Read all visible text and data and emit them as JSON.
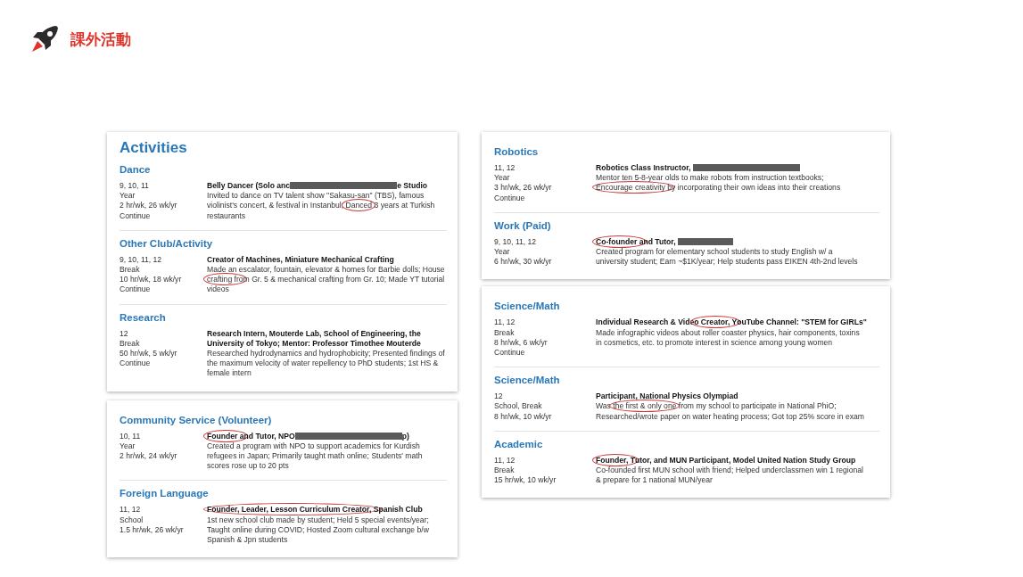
{
  "header": {
    "title": "課外活動"
  },
  "columns": [
    {
      "cards": [
        {
          "heading": "Activities",
          "entries": [
            {
              "category": "Dance",
              "meta": [
                "9, 10, 11",
                "Year",
                "2 hr/wk, 26 wk/yr",
                "Continue"
              ],
              "title": [
                {
                  "kind": "text",
                  "text": "Belly Dancer (Solo anc"
                },
                {
                  "kind": "redacted_long"
                },
                {
                  "kind": "text",
                  "text": "e Studio"
                }
              ],
              "description": [
                {
                  "kind": "text",
                  "text": "Invited to dance on TV talent show \"Sakasu-san\" (TBS), famous violinist's concert, & festival in Instanbul; "
                },
                {
                  "kind": "text",
                  "text": "Danced",
                  "circled": true
                },
                {
                  "kind": "text",
                  "text": " 3 years at Turkish restaurants"
                }
              ]
            },
            {
              "category": "Other Club/Activity",
              "meta": [
                "9, 10, 11, 12",
                "Break",
                "10 hr/wk, 18 wk/yr",
                "Continue"
              ],
              "title": [
                {
                  "kind": "text",
                  "text": "Creator of Machines, Miniature Mechanical Crafting"
                }
              ],
              "description": [
                {
                  "kind": "text",
                  "text": "Made an escalator, fountain, elevator & homes for Barbie dolls; House "
                },
                {
                  "kind": "text",
                  "text": "crafting fro",
                  "circled": true
                },
                {
                  "kind": "text",
                  "text": "m Gr. 5 & mechanical crafting from Gr. 10; Made YT tutorial videos"
                }
              ]
            },
            {
              "category": "Research",
              "meta": [
                "12",
                "Break",
                "50 hr/wk, 5 wk/yr",
                "Continue"
              ],
              "title": [
                {
                  "kind": "text",
                  "text": "Research Intern, Mouterde Lab, School of Engineering, the University of Tokyo; Mentor: Professor Timothee Mouterde"
                }
              ],
              "description": [
                {
                  "kind": "text",
                  "text": "Researched hydrodynamics and hydrophobicity; Presented findings of the maximum velocity of water repellency to PhD students; 1st HS & female intern"
                }
              ]
            }
          ]
        },
        {
          "entries": [
            {
              "category": "Community Service (Volunteer)",
              "meta": [
                "10, 11",
                "Year",
                "2 hr/wk, 24 wk/yr"
              ],
              "title": [
                {
                  "kind": "text",
                  "text": "Founder a",
                  "circled": true
                },
                {
                  "kind": "text",
                  "text": "nd Tutor, NPO"
                },
                {
                  "kind": "redacted_long"
                },
                {
                  "kind": "text",
                  "text": "p)"
                }
              ],
              "description": [
                {
                  "kind": "text",
                  "text": "Created a program with NPO to support academics for Kurdish refugees in Japan; Primarily taught math online; Students' math scores rose up to 20 pts"
                }
              ]
            },
            {
              "category": "Foreign Language",
              "meta": [
                "11, 12",
                "School",
                "1.5 hr/wk, 26 wk/yr"
              ],
              "title": [
                {
                  "kind": "text",
                  "text": "Founder, Leader, Lesson Curriculum Creator, S",
                  "circled": true
                },
                {
                  "kind": "text",
                  "text": "panish Club"
                }
              ],
              "description": [
                {
                  "kind": "text",
                  "text": "1st new school club made by student; Held 5 special events/year; Taught online during COVID; Hosted Zoom cultural exchange b/w Spanish & Jpn students"
                }
              ]
            }
          ]
        }
      ]
    },
    {
      "cards": [
        {
          "entries": [
            {
              "category": "Robotics",
              "meta": [
                "11, 12",
                "Year",
                "3 hr/wk, 26 wk/yr",
                "Continue"
              ],
              "title": [
                {
                  "kind": "text",
                  "text": "Robotics Class Instructor, "
                },
                {
                  "kind": "redacted_long"
                }
              ],
              "description": [
                {
                  "kind": "text",
                  "text": "Mentor ten 5-8-year olds to make robots from instruction textbooks; "
                },
                {
                  "kind": "text",
                  "text": "Encourage creativity b",
                  "circled": true
                },
                {
                  "kind": "text",
                  "text": "y incorporating their own ideas into their creations"
                }
              ]
            },
            {
              "category": "Work (Paid)",
              "meta": [
                "9, 10, 11, 12",
                "Year",
                "6 hr/wk, 30 wk/yr"
              ],
              "title": [
                {
                  "kind": "text",
                  "text": "Co-founder a",
                  "circled": true
                },
                {
                  "kind": "text",
                  "text": "nd Tutor, "
                },
                {
                  "kind": "redacted_short"
                }
              ],
              "description": [
                {
                  "kind": "text",
                  "text": "Created program for elementary school students to study English w/ a university student; Earn ~$1K/year; Help students pass EIKEN 4th-2nd levels"
                }
              ]
            }
          ]
        },
        {
          "entries": [
            {
              "category": "Science/Math",
              "meta": [
                "11, 12",
                "Break",
                "8 hr/wk, 6 wk/yr",
                "Continue"
              ],
              "title": [
                {
                  "kind": "text",
                  "text": "Individual Research & Vide"
                },
                {
                  "kind": "text",
                  "text": "o Creator, Y",
                  "circled": true
                },
                {
                  "kind": "text",
                  "text": "ouTube Channel: \"STEM for GIRLs\""
                }
              ],
              "description": [
                {
                  "kind": "text",
                  "text": "Made infographic videos about roller coaster physics, hair components, toxins in cosmetics, etc. to promote interest in science among young women"
                }
              ]
            },
            {
              "category": "Science/Math",
              "meta": [
                "12",
                "School, Break",
                "8 hr/wk, 10 wk/yr"
              ],
              "title": [
                {
                  "kind": "text",
                  "text": "Participant, National Physics Olympiad"
                }
              ],
              "description": [
                {
                  "kind": "text",
                  "text": "Was "
                },
                {
                  "kind": "text",
                  "text": "the first & only one",
                  "circled": true
                },
                {
                  "kind": "text",
                  "text": " from my school to participate in National PhiO; Researched/wrote paper on water heating process; Got top 25% score in exam"
                }
              ]
            },
            {
              "category": "Academic",
              "meta": [
                "11, 12",
                "Break",
                "15 hr/wk, 10 wk/yr"
              ],
              "title": [
                {
                  "kind": "text",
                  "text": "Founder, T",
                  "circled": true
                },
                {
                  "kind": "text",
                  "text": "utor, and MUN Participant, Model United Nation Study Group"
                }
              ],
              "description": [
                {
                  "kind": "text",
                  "text": "Co-founded first MUN school with friend; Helped underclassmen win 1 regional & prepare for 1 national MUN/year"
                }
              ]
            }
          ]
        }
      ]
    }
  ]
}
